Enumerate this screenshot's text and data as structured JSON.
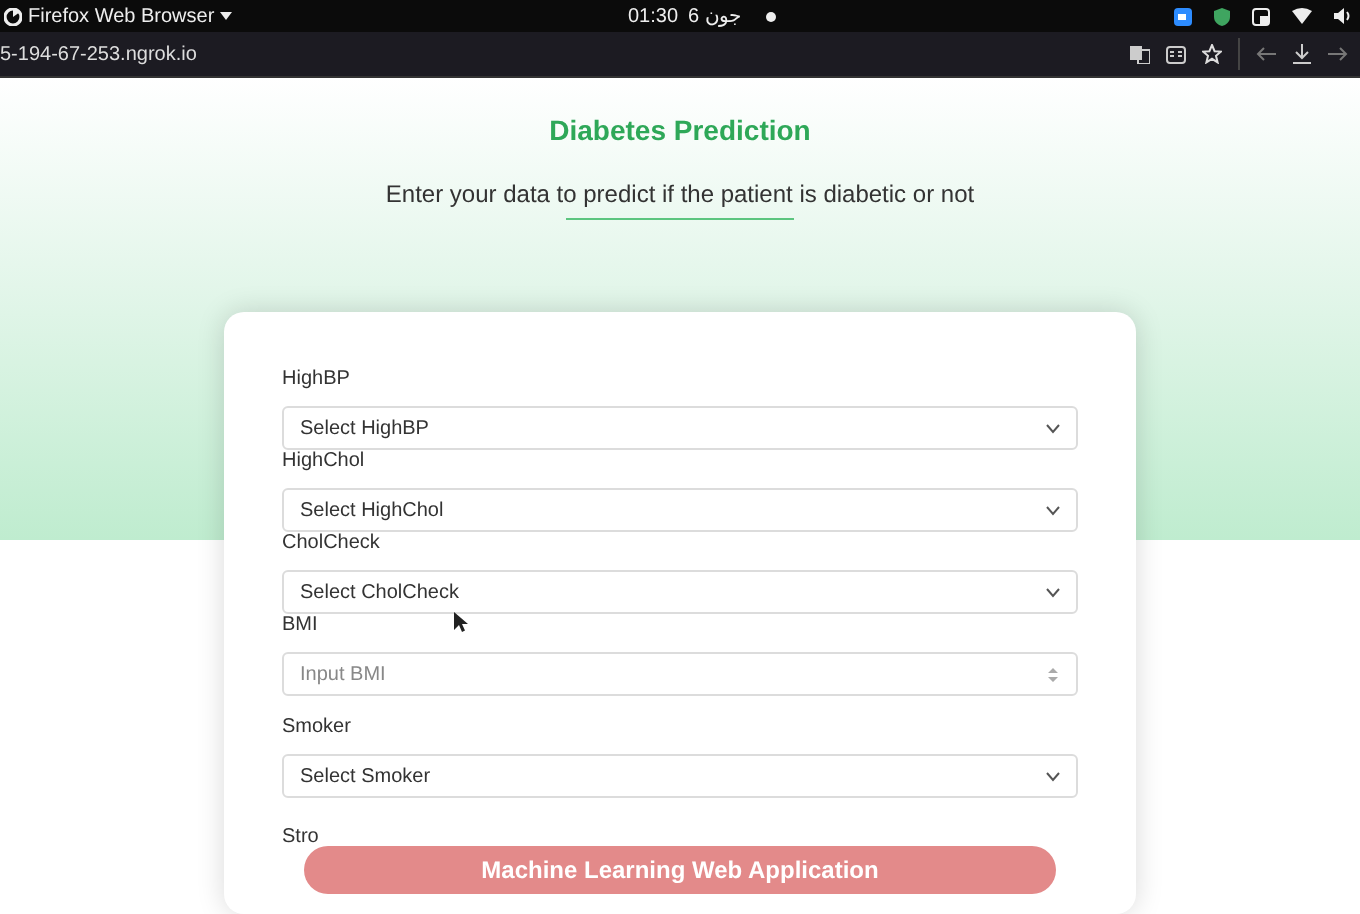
{
  "top_bar": {
    "app_name": "Firefox Web Browser",
    "time": "01:30",
    "date": "جون 6"
  },
  "address_bar": {
    "url": "5-194-67-253.ngrok.io"
  },
  "page": {
    "title": "Diabetes Prediction",
    "subtitle": "Enter your data to predict if the patient is diabetic or not",
    "fields": [
      {
        "label": "HighBP",
        "kind": "select",
        "placeholder": "Select HighBP"
      },
      {
        "label": "HighChol",
        "kind": "select",
        "placeholder": "Select HighChol"
      },
      {
        "label": "CholCheck",
        "kind": "select",
        "placeholder": "Select CholCheck"
      },
      {
        "label": "BMI",
        "kind": "number",
        "placeholder": "Input BMI"
      },
      {
        "label": "Smoker",
        "kind": "select",
        "placeholder": "Select Smoker"
      },
      {
        "label": "Stro",
        "kind": "label_only"
      }
    ]
  },
  "banner": {
    "text": "Machine Learning Web Application"
  }
}
